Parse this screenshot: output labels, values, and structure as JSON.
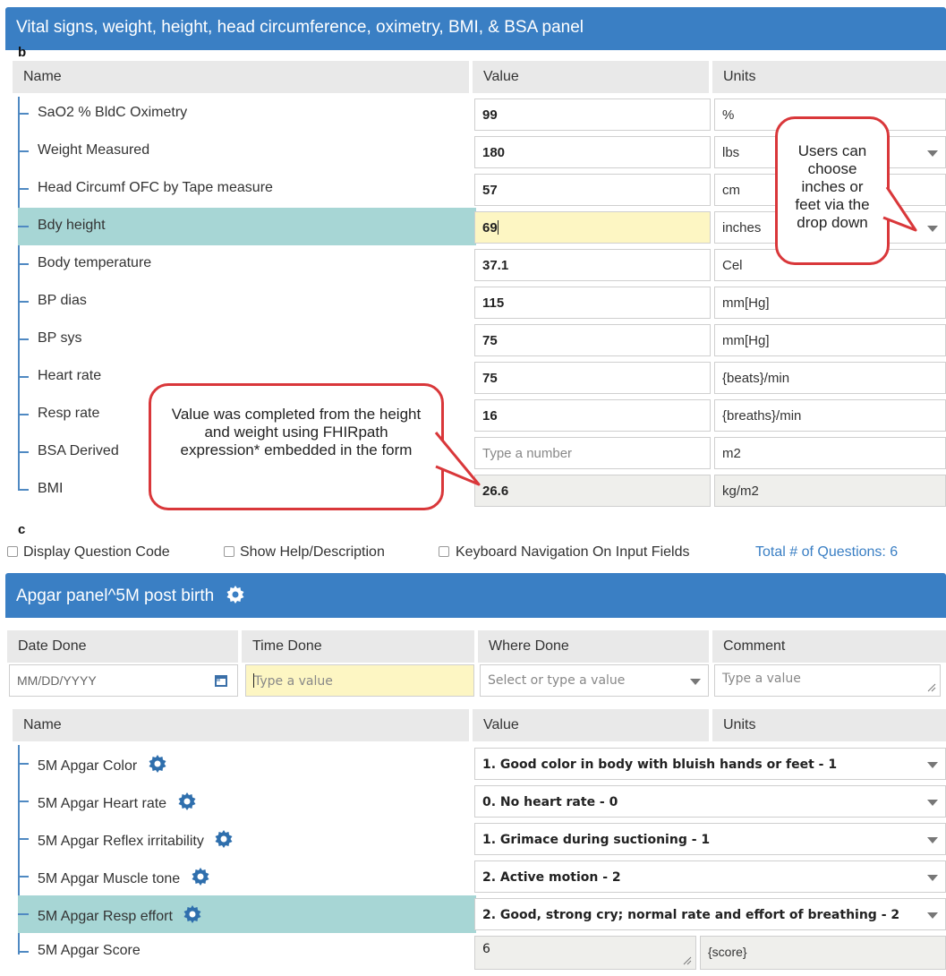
{
  "vitals": {
    "header": "Vital signs, weight, height, head circumference, oximetry, BMI, & BSA panel",
    "letter": "b",
    "columns": {
      "name": "Name",
      "value": "Value",
      "units": "Units"
    },
    "rows": [
      {
        "name": "SaO2 % BldC Oximetry",
        "value": "99",
        "unit": "%"
      },
      {
        "name": "Weight Measured",
        "value": "180",
        "unit": "lbs"
      },
      {
        "name": "Head Circumf OFC by Tape measure",
        "value": "57",
        "unit": "cm"
      },
      {
        "name": "Bdy height",
        "value": "69",
        "unit": "inches"
      },
      {
        "name": "Body temperature",
        "value": "37.1",
        "unit": "Cel"
      },
      {
        "name": "BP dias",
        "value": "115",
        "unit": "mm[Hg]"
      },
      {
        "name": "BP sys",
        "value": "75",
        "unit": "mm[Hg]"
      },
      {
        "name": "Heart rate",
        "value": "75",
        "unit": "{beats}/min"
      },
      {
        "name": "Resp rate",
        "value": "16",
        "unit": "{breaths}/min"
      },
      {
        "name": "BSA Derived",
        "placeholder": "Type a number",
        "unit": "m2"
      },
      {
        "name": "BMI",
        "value": "26.6",
        "unit": "kg/m2"
      }
    ],
    "callout_units": "Users can choose inches or feet via the drop down",
    "callout_value": "Value was completed from the height and weight using FHIRpath expression* embedded in the form"
  },
  "options": {
    "letter": "c",
    "display_code": "Display Question Code",
    "show_help": "Show Help/Description",
    "keyboard_nav": "Keyboard Navigation On Input Fields",
    "total": "Total # of Questions: 6"
  },
  "apgar": {
    "header": "Apgar panel^5M post birth",
    "meta_columns": {
      "date": "Date Done",
      "time": "Time Done",
      "where": "Where Done",
      "comment": "Comment"
    },
    "date_placeholder": "MM/DD/YYYY",
    "time_placeholder": "Type a value",
    "where_placeholder": "Select or type a value",
    "comment_placeholder": "Type a value",
    "columns": {
      "name": "Name",
      "value": "Value",
      "units": "Units"
    },
    "rows": [
      {
        "name": "5M Apgar Color",
        "value": "1. Good color in body with bluish hands or feet - 1"
      },
      {
        "name": "5M Apgar Heart rate",
        "value": "0. No heart rate - 0"
      },
      {
        "name": "5M Apgar Reflex irritability",
        "value": "1. Grimace during suctioning - 1"
      },
      {
        "name": "5M Apgar Muscle tone",
        "value": "2. Active motion - 2"
      },
      {
        "name": "5M Apgar Resp effort",
        "value": "2. Good, strong cry; normal rate and effort of breathing - 2"
      }
    ],
    "score": {
      "name": "5M Apgar Score",
      "value": "6",
      "unit": "{score}"
    }
  },
  "colors": {
    "header_blue": "#3a7fc4",
    "highlight_teal": "#a7d6d5",
    "callout_red": "#d9373a",
    "input_yellow": "#fdf6c3"
  }
}
